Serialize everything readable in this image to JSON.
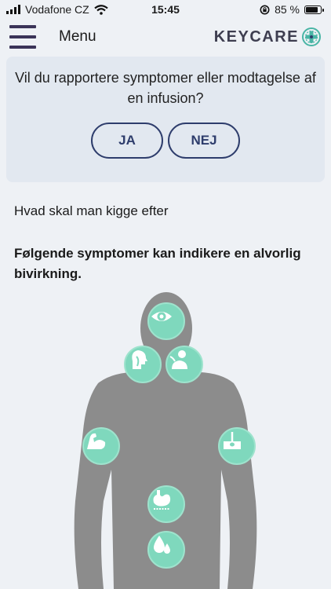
{
  "status_bar": {
    "carrier": "Vodafone CZ",
    "time": "15:45",
    "battery": "85 %",
    "battery_level": 0.85
  },
  "header": {
    "menu_label": "Menu",
    "brand": "KEYCARE"
  },
  "question": {
    "text": "Vil du rapportere symptomer eller modtagelse af en infusion?",
    "yes_label": "JA",
    "no_label": "NEJ"
  },
  "content": {
    "what_to_look_for": "Hvad skal man kigge efter",
    "warning": "Følgende symptomer kan indikere en alvorlig bivirkning."
  },
  "symptoms": [
    {
      "icon": "eye-icon"
    },
    {
      "icon": "throat-icon"
    },
    {
      "icon": "breathing-icon"
    },
    {
      "icon": "muscle-arm-icon"
    },
    {
      "icon": "skin-icon"
    },
    {
      "icon": "stomach-icon"
    },
    {
      "icon": "drops-icon"
    }
  ],
  "colors": {
    "background": "#eef1f5",
    "card": "#e2e8f0",
    "accent_mint": "#7fd8bd",
    "button_navy": "#2e3d6c",
    "silhouette": "#8c8c8c",
    "brand_teal": "#49b5a5"
  }
}
